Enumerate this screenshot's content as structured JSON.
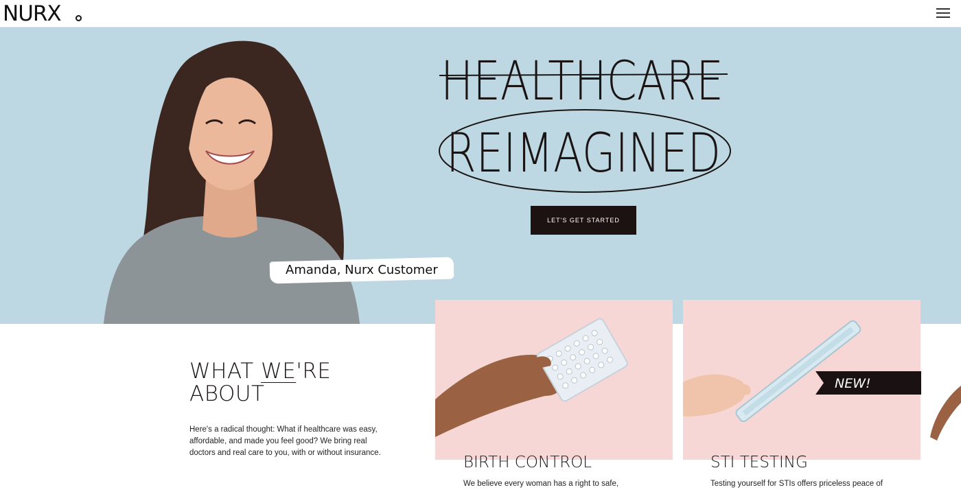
{
  "header": {
    "logo": "NURX",
    "menu_icon": "hamburger-menu-icon"
  },
  "hero": {
    "headline_line1": "HEALTHCARE",
    "headline_line2": "REIMAGINED",
    "cta_label": "LET'S GET STARTED",
    "caption": "Amanda, Nurx Customer",
    "background_color": "#bdd8e2"
  },
  "about": {
    "title_part1": "WHAT ",
    "title_we": "WE",
    "title_part2": "'RE",
    "title_line2": "ABOUT",
    "body": "Here's a radical thought: What if healthcare was easy, affordable, and made you feel good? We bring real doctors and real care to you, with or without insurance."
  },
  "services": [
    {
      "title": "BIRTH CONTROL",
      "description": "We believe every woman has a right to safe,",
      "image_icon": "birth-control-pills-icon"
    },
    {
      "title": "STI TESTING",
      "description": "Testing yourself for STIs offers priceless peace of",
      "badge": "NEW!",
      "image_icon": "sti-test-swab-icon"
    }
  ],
  "colors": {
    "card_pink": "#f6d7d5",
    "button_dark": "#1d1212"
  }
}
